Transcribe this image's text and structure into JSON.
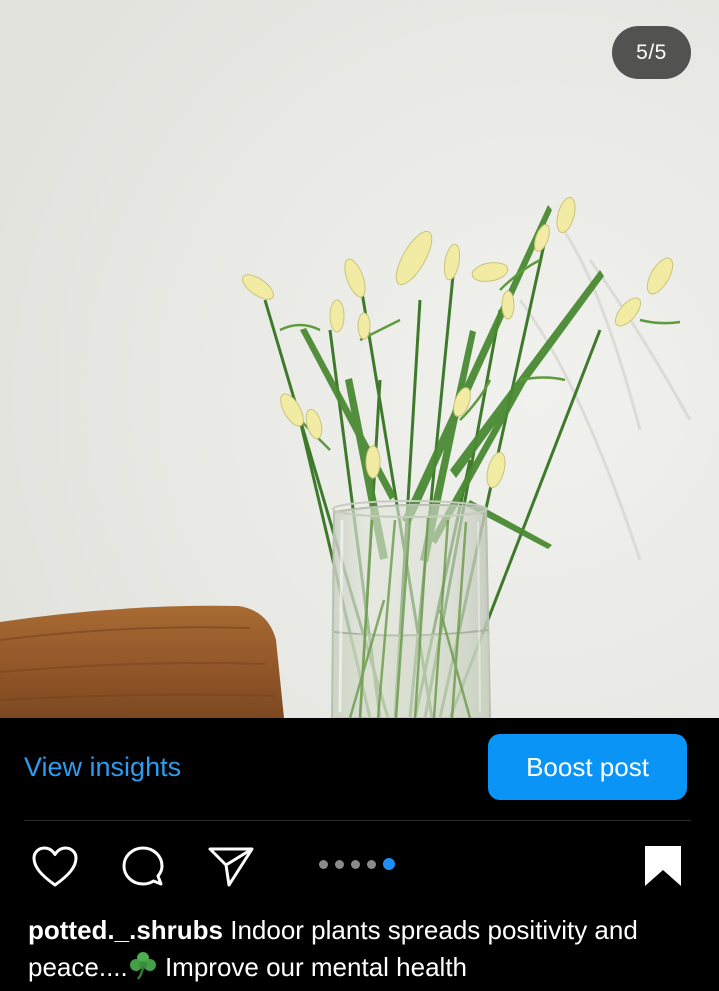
{
  "post": {
    "image_counter": "5/5",
    "carousel": {
      "total": 5,
      "current": 5
    }
  },
  "actions": {
    "view_insights_label": "View insights",
    "boost_post_label": "Boost post"
  },
  "icons": {
    "like": "heart-icon",
    "comment": "comment-icon",
    "share": "paper-plane-icon",
    "save": "bookmark-icon"
  },
  "caption": {
    "username": "potted._.shrubs",
    "text_before_emoji": " Indoor plants spreads positivity and peace....",
    "emoji": "shamrock",
    "text_after_emoji": " Improve our mental health"
  },
  "colors": {
    "link": "#2d9cf0",
    "button": "#0a95f6",
    "active_dot": "#1f8ff5",
    "background": "#000000"
  }
}
